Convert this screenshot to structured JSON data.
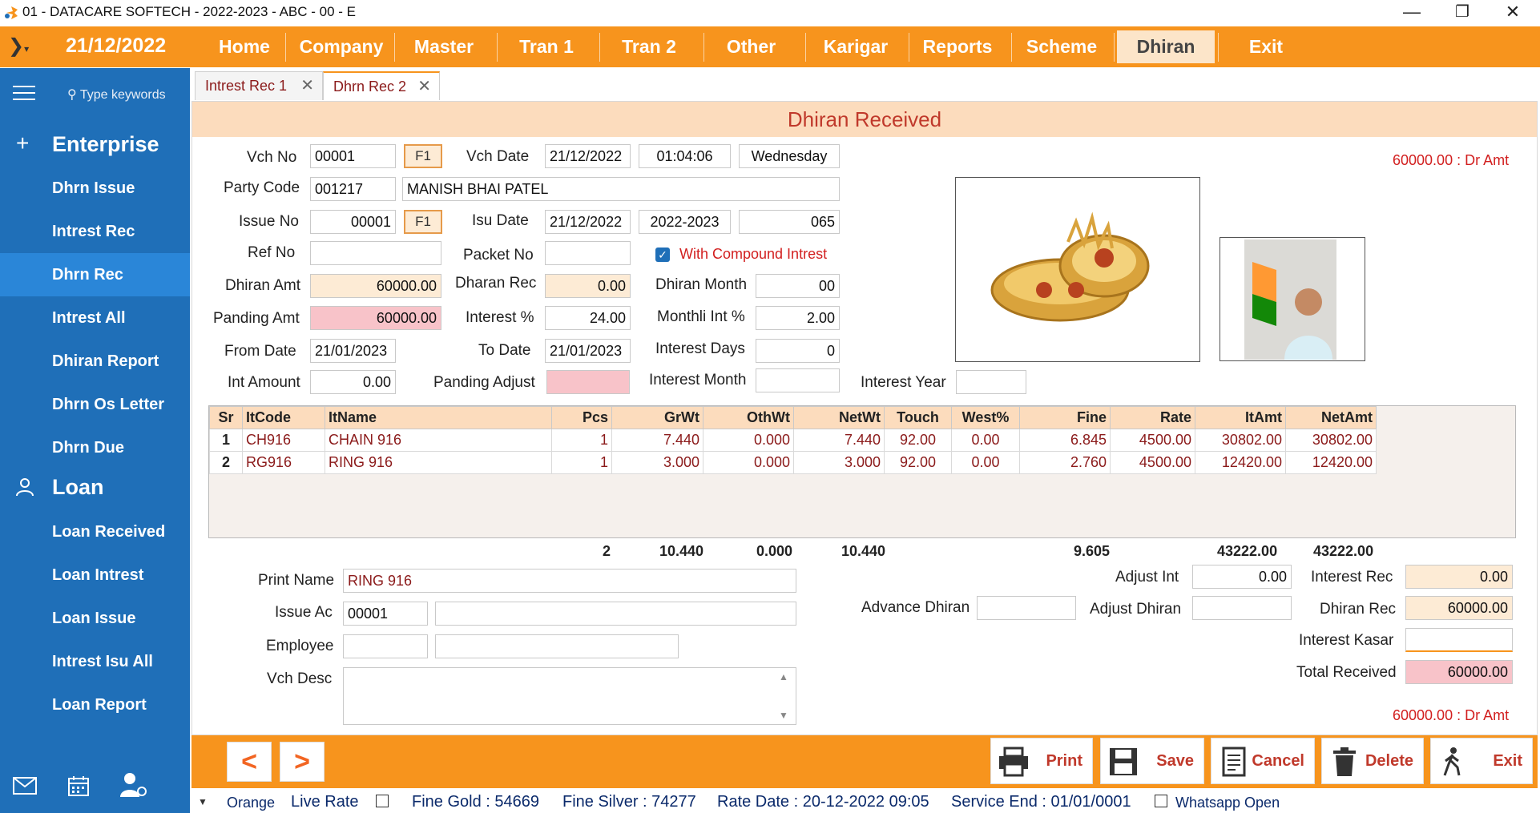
{
  "window": {
    "title": "01 - DATACARE SOFTECH - 2022-2023 - ABC - 00 - E",
    "controls": [
      "—",
      "❐",
      "✕"
    ]
  },
  "menubar": {
    "date": "21/12/2022",
    "items": [
      "Home",
      "Company",
      "Master",
      "Tran 1",
      "Tran 2",
      "Other",
      "Karigar",
      "Reports",
      "Scheme",
      "Dhiran",
      "Exit"
    ],
    "active": "Dhiran"
  },
  "sidebar": {
    "search_placeholder": "Type keywords",
    "sections": [
      {
        "title": "Enterprise",
        "items": [
          "Dhrn Issue",
          "Intrest Rec",
          "Dhrn Rec",
          "Intrest All",
          "Dhiran Report",
          "Dhrn Os Letter",
          "Dhrn Due"
        ]
      },
      {
        "title": "Loan",
        "items": [
          "Loan Received",
          "Loan Intrest",
          "Loan Issue",
          "Intrest Isu All",
          "Loan Report"
        ]
      }
    ],
    "active_item": "Dhrn Rec"
  },
  "tabs": [
    "Intrest Rec 1",
    "Dhrn Rec 2"
  ],
  "form": {
    "title": "Dhiran Received",
    "dr_amt_top": "60000.00 : Dr Amt",
    "labels": {
      "vch_no": "Vch No",
      "vch_date": "Vch Date",
      "party_code": "Party Code",
      "issue_no": "Issue No",
      "isu_date": "Isu Date",
      "ref_no": "Ref No",
      "packet_no": "Packet No",
      "compound": "With Compound Intrest",
      "dhiran_amt": "Dhiran Amt",
      "dharan_rec": "Dharan Rec",
      "dhiran_month": "Dhiran Month",
      "panding_amt": "Panding Amt",
      "interest_pct": "Interest %",
      "monthli_int": "Monthli Int %",
      "from_date": "From Date",
      "to_date": "To Date",
      "interest_days": "Interest Days",
      "int_amount": "Int Amount",
      "panding_adjust": "Panding Adjust",
      "interest_month": "Interest Month",
      "interest_year": "Interest Year",
      "f1": "F1"
    },
    "values": {
      "vch_no": "00001",
      "vch_date": "21/12/2022",
      "vch_time": "01:04:06",
      "vch_day": "Wednesday",
      "party_code": "001217",
      "party_name": "MANISH BHAI PATEL",
      "issue_no": "00001",
      "isu_date": "21/12/2022",
      "isu_year": "2022-2023",
      "isu_code": "065",
      "ref_no": "",
      "packet_no": "",
      "dhiran_amt": "60000.00",
      "dharan_rec": "0.00",
      "dhiran_month": "00",
      "panding_amt": "60000.00",
      "interest_pct": "24.00",
      "monthli_int": "2.00",
      "from_date": "21/01/2023",
      "to_date": "21/01/2023",
      "interest_days": "0",
      "int_amount": "0.00",
      "panding_adjust": "",
      "interest_month": "",
      "interest_year": ""
    }
  },
  "grid": {
    "columns": [
      "Sr",
      "ItCode",
      "ItName",
      "Pcs",
      "GrWt",
      "OthWt",
      "NetWt",
      "Touch",
      "West%",
      "Fine",
      "Rate",
      "ItAmt",
      "NetAmt"
    ],
    "rows": [
      [
        "1",
        "CH916",
        "CHAIN 916",
        "1",
        "7.440",
        "0.000",
        "7.440",
        "92.00",
        "0.00",
        "6.845",
        "4500.00",
        "30802.00",
        "30802.00"
      ],
      [
        "2",
        "RG916",
        "RING 916",
        "1",
        "3.000",
        "0.000",
        "3.000",
        "92.00",
        "0.00",
        "2.760",
        "4500.00",
        "12420.00",
        "12420.00"
      ]
    ],
    "totals": {
      "pcs": "2",
      "grwt": "10.440",
      "othwt": "0.000",
      "netwt": "10.440",
      "fine": "9.605",
      "itamt": "43222.00",
      "netamt": "43222.00"
    }
  },
  "lower": {
    "labels": {
      "print_name": "Print Name",
      "issue_ac": "Issue Ac",
      "employee": "Employee",
      "vch_desc": "Vch Desc",
      "advance_dhiran": "Advance Dhiran",
      "adjust_int": "Adjust Int",
      "adjust_dhiran": "Adjust Dhiran",
      "interest_rec": "Interest Rec",
      "dhiran_rec": "Dhiran Rec",
      "interest_kasar": "Interest Kasar",
      "total_received": "Total Received"
    },
    "values": {
      "print_name": "RING 916",
      "issue_ac": "00001",
      "issue_ac_name": "",
      "employee": "",
      "employee_name": "",
      "vch_desc": "",
      "advance_dhiran": "",
      "adjust_int": "0.00",
      "adjust_dhiran": "",
      "interest_rec": "0.00",
      "dhiran_rec": "60000.00",
      "interest_kasar": "",
      "total_received": "60000.00"
    },
    "dr_amt_bottom": "60000.00 : Dr Amt"
  },
  "toolbar": {
    "prev": "<",
    "next": ">",
    "buttons": [
      "Print",
      "Save",
      "Cancel",
      "Delete",
      "Exit"
    ]
  },
  "status": {
    "theme": "Orange",
    "live_rate": "Live Rate",
    "fine_gold": "Fine Gold : 54669",
    "fine_silver": "Fine Silver : 74277",
    "rate_date": "Rate Date : 20-12-2022 09:05",
    "service_end": "Service End :  01/01/0001",
    "whatsapp": "Whatsapp Open"
  },
  "colors": {
    "accent": "#f7941d",
    "sidebar": "#1f6fb8",
    "header_bg": "#fcdcbd",
    "red_text": "#d21f1f"
  }
}
